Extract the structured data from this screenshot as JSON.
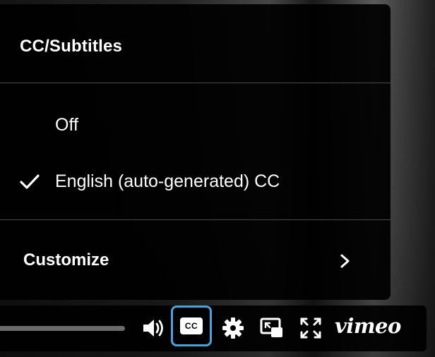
{
  "cc_menu": {
    "title": "CC/Subtitles",
    "options": [
      {
        "label": "Off",
        "selected": false
      },
      {
        "label": "English (auto-generated) CC",
        "selected": true
      }
    ],
    "customize_label": "Customize"
  },
  "controls": {
    "cc_badge_text": "CC",
    "brand": "vimeo",
    "volume_icon": "speaker-icon",
    "settings_icon": "gear-icon",
    "pip_icon": "picture-in-picture-icon",
    "fullscreen_icon": "fullscreen-icon",
    "focus_ring_color": "#4aa3df"
  }
}
